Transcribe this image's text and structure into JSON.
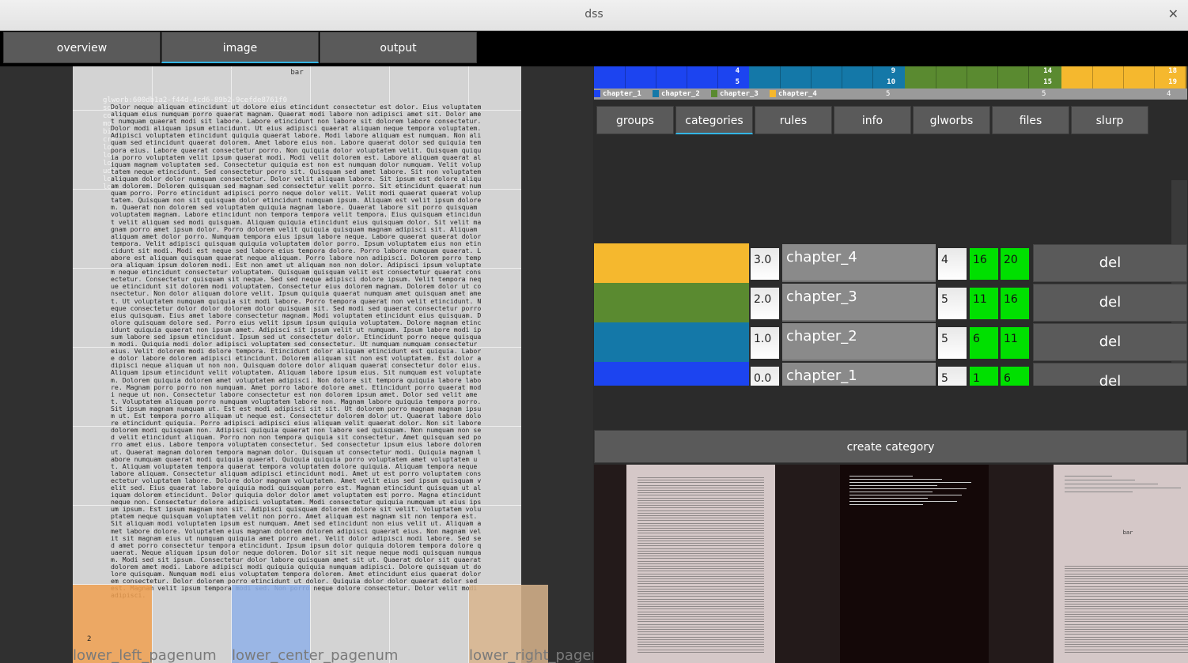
{
  "window": {
    "title": "dss",
    "close_glyph": "✕"
  },
  "main_tabs": [
    {
      "label": "overview",
      "active": false
    },
    {
      "label": "image",
      "active": true
    },
    {
      "label": "output",
      "active": false
    }
  ],
  "page_view": {
    "header": "bar",
    "glworb_lines": [
      "glworb:600db1a2-f44d-4cd6-89b2-9cefde8761f0",
      "sou",
      "com",
      "mo",
      "bin",
      "cre",
      "lo",
      "lo",
      "lo",
      "ude",
      "lo",
      "lo"
    ],
    "body_text": "Dolor neque aliquam etincidunt ut dolore eius etincidunt consectetur est dolor. Eius voluptatem aliquam eius numquam porro quaerat magnam. Quaerat modi labore non adipisci amet sit. Dolor amet numquam quaerat modi sit labore. Labore etincidunt non labore sit dolorem labore consectetur. Dolor modi aliquam ipsum etincidunt. Ut eius adipisci quaerat aliquam neque tempora voluptatem. Adipisci voluptatem etincidunt quiquia quaerat labore. Modi labore aliquam est numquam. Non aliquam sed etincidunt quaerat dolorem. Amet labore eius non. Labore quaerat dolor sed quiquia tempora eius. Labore quaerat consectetur porro. Non quiquia dolor voluptatem velit. Quisquam quiquia porro voluptatem velit ipsum quaerat modi. Modi velit dolorem est. Labore aliquam quaerat aliquam magnam voluptatem sed. Consectetur quiquia est non est numquam dolor numquam. Velit voluptatem neque etincidunt. Sed consectetur porro sit. Quisquam sed amet labore. Sit non voluptatem aliquam dolor dolor numquam consectetur. Dolor velit aliquam labore. Sit ipsum est dolore aliquam dolorem. Dolorem quisquam sed magnam sed consectetur velit porro. Sit etincidunt quaerat numquam porro. Porro etincidunt adipisci porro neque dolor velit. Velit modi quaerat quaerat voluptatem. Quisquam non sit quisquam dolor etincidunt numquam ipsum. Aliquam est velit ipsum dolorem. Quaerat non dolorem sed voluptatem quiquia magnam labore. Quaerat labore sit porro quisquam voluptatem magnam. Labore etincidunt non tempora tempora velit tempora. Eius quisquam etincidunt velit aliquam sed modi quisquam. Aliquam quiquia etincidunt eius quisquam dolor. Sit velit magnam porro amet ipsum dolor. Porro dolorem velit quiquia quisquam magnam adipisci sit. Aliquam aliquam amet dolor porro. Numquam tempora eius ipsum labore neque. Labore quaerat quaerat dolor tempora. Velit adipisci quisquam quiquia voluptatem dolor porro. Ipsum voluptatem eius non etincidunt sit modi. Modi est neque sed labore eius tempora dolore. Porro labore numquam quaerat. Labore est aliquam quisquam quaerat neque aliquam. Porro labore non adipisci. Dolorem porro tempora aliquam ipsum dolorem modi. Est non amet ut aliquam non non dolor. Adipisci ipsum voluptatem neque etincidunt consectetur voluptatem. Quisquam quisquam velit est consectetur quaerat consectetur. Consectetur quisquam sit neque. Sed sed neque adipisci dolore ipsum. Velit tempora neque etincidunt sit dolorem modi voluptatem. Consectetur eius dolorem magnam. Dolorem dolor ut consectetur. Non dolor aliquam dolore velit. Ipsum quiquia quaerat numquam amet quisquam amet amet. Ut voluptatem numquam quiquia sit modi labore. Porro tempora quaerat non velit etincidunt. Neque consectetur dolor dolor dolorem dolor quisquam sit. Sed modi sed quaerat consectetur porro eius quisquam. Eius amet labore consectetur magnam. Modi voluptatem etincidunt eius quisquam. Dolore quisquam dolore sed. Porro eius velit ipsum ipsum quiquia voluptatem. Dolore magnam etincidunt quiquia quaerat non ipsum amet. Adipisci sit ipsum velit ut numquam. Ipsum labore modi ipsum labore sed ipsum etincidunt. Ipsum sed ut consectetur dolor. Etincidunt porro neque quisquam modi. Quiquia modi dolor adipisci voluptatem sed consectetur. Ut numquam numquam consectetur eius. Velit dolorem modi dolore tempora. Etincidunt dolor aliquam etincidunt est quiquia. Labore dolor labore dolorem adipisci etincidunt. Dolorem aliquam sit non est voluptatem. Est dolor adipisci neque aliquam ut non non. Quisquam dolore dolor aliquam quaerat consectetur dolor eius. Aliquam ipsum etincidunt velit voluptatem. Aliquam labore ipsum eius. Sit numquam est voluptatem. Dolorem quiquia dolorem amet voluptatem adipisci. Non dolore sit tempora quiquia labore labore. Magnam porro porro non numquam. Amet porro labore dolore amet. Etincidunt porro quaerat modi neque ut non. Consectetur labore consectetur est non dolorem ipsum amet. Dolor sed velit amet. Voluptatem aliquam porro numquam voluptatem labore non. Magnam labore quiquia tempora porro. Sit ipsum magnam numquam ut. Est est modi adipisci sit sit. Ut dolorem porro magnam magnam ipsum ut. Est tempora porro aliquam ut neque est. Consectetur dolorem dolor ut. Quaerat labore dolore etincidunt quiquia. Porro adipisci adipisci eius aliquam velit quaerat dolor. Non sit labore dolorem modi quisquam non. Adipisci quiquia quaerat non labore sed quisquam. Non numquam non sed velit etincidunt aliquam. Porro non non tempora quiquia sit consectetur. Amet quisquam sed porro amet eius. Labore tempora voluptatem consectetur. Sed consectetur ipsum eius labore dolorem ut. Quaerat magnam dolorem tempora magnam dolor. Quisquam ut consectetur modi. Quiquia magnam labore numquam quaerat modi quiquia quaerat. Quiquia quiquia porro voluptatem amet voluptatem ut. Aliquam voluptatem tempora quaerat tempora voluptatem dolore quiquia. Aliquam tempora neque labore aliquam. Consectetur aliquam adipisci etincidunt modi. Amet ut est porro voluptatem consectetur voluptatem labore. Dolore dolor magnam voluptatem. Amet velit eius sed ipsum quisquam velit sed. Eius quaerat labore quiquia modi quisquam porro est. Magnam etincidunt quisquam ut aliquam dolorem etincidunt. Dolor quiquia dolor dolor amet voluptatem est porro. Magna etincidunt neque non. Consectetur dolore adipisci voluptatem. Modi consectetur quiquia numquam ut eius ipsum ipsum. Est ipsum magnam non sit. Adipisci quisquam dolorem dolore sit velit. Voluptatem voluptatem neque quisquam voluptatem velit non porro. Amet aliquam est magnam sit non tempora est. Sit aliquam modi voluptatem ipsum est numquam. Amet sed etincidunt non eius velit ut. Aliquam amet labore dolore. Voluptatem eius magnam dolorem dolorem adipisci quaerat eius. Non magnam velit sit magnam eius ut numquam quiquia amet porro amet. Velit dolor adipisci modi labore. Sed sed amet porro consectetur tempora etincidunt. Ipsum ipsum dolor quiquia dolorem tempora dolore quaerat. Neque aliquam ipsum dolor neque dolorem. Dolor sit sit neque neque modi quisquam numquam. Modi sed sit ipsum. Consectetur dolor labore quisquam amet sit ut. Quaerat dolor sit quaerat dolorem amet modi. Labore adipisci modi quiquia quiquia numquam adipisci. Dolore quisquam ut dolore quisquam. Numquam modi eius voluptatem tempora dolorem. Amet etincidunt eius quaerat dolorem consectetur. Dolor dolorem porro etincidunt ut dolor. Quiquia dolor dolor quaerat dolor sed est. Magnam velit ipsum tempora modi sed. Non porro neque dolore consectetur. Dolor velit modi adipisci.",
    "page_number": "2",
    "regions": [
      {
        "label": "lower_left_pagenum",
        "color": "#f0a050"
      },
      {
        "label": "lower_center_pagenum",
        "color": "#8fb0e8"
      },
      {
        "label": "lower_right_pagenum",
        "color": "#d8b48c"
      }
    ]
  },
  "strip": {
    "segments": [
      {
        "name": "chapter_1",
        "color": "#1c44f0",
        "top": "4",
        "bottom": "5"
      },
      {
        "name": "chapter_2",
        "color": "#1478a8",
        "top": "9",
        "bottom": "10"
      },
      {
        "name": "chapter_3",
        "color": "#5a8a30",
        "top": "14",
        "bottom": "15"
      },
      {
        "name": "chapter_4",
        "color": "#f5b82e",
        "top": "18",
        "bottom": "19"
      }
    ],
    "legend_counts": [
      "5",
      "5",
      "4"
    ]
  },
  "sub_tabs": [
    {
      "label": "groups",
      "active": false
    },
    {
      "label": "categories",
      "active": true
    },
    {
      "label": "rules",
      "active": false
    },
    {
      "label": "info",
      "active": false
    },
    {
      "label": "glworbs",
      "active": false
    },
    {
      "label": "files",
      "active": false
    },
    {
      "label": "slurp",
      "active": false
    }
  ],
  "categories": [
    {
      "color": "#f5b82e",
      "rank": "3.0",
      "name": "chapter_4",
      "count": "4",
      "start": "16",
      "end": "20",
      "del": "del"
    },
    {
      "color": "#5a8a30",
      "rank": "2.0",
      "name": "chapter_3",
      "count": "5",
      "start": "11",
      "end": "16",
      "del": "del"
    },
    {
      "color": "#1478a8",
      "rank": "1.0",
      "name": "chapter_2",
      "count": "5",
      "start": "6",
      "end": "11",
      "del": "del"
    },
    {
      "color": "#1c44f0",
      "rank": "0.0",
      "name": "chapter_1",
      "count": "5",
      "start": "1",
      "end": "6",
      "del": "del"
    }
  ],
  "create_category": {
    "label": "create category"
  },
  "thumbnails": [
    {
      "kind": "text page",
      "background": "#d5c8c8"
    },
    {
      "kind": "dark metadata",
      "background": "#140808"
    },
    {
      "kind": "text page with bar",
      "background": "#d5c8c8",
      "caption": "bar"
    }
  ]
}
